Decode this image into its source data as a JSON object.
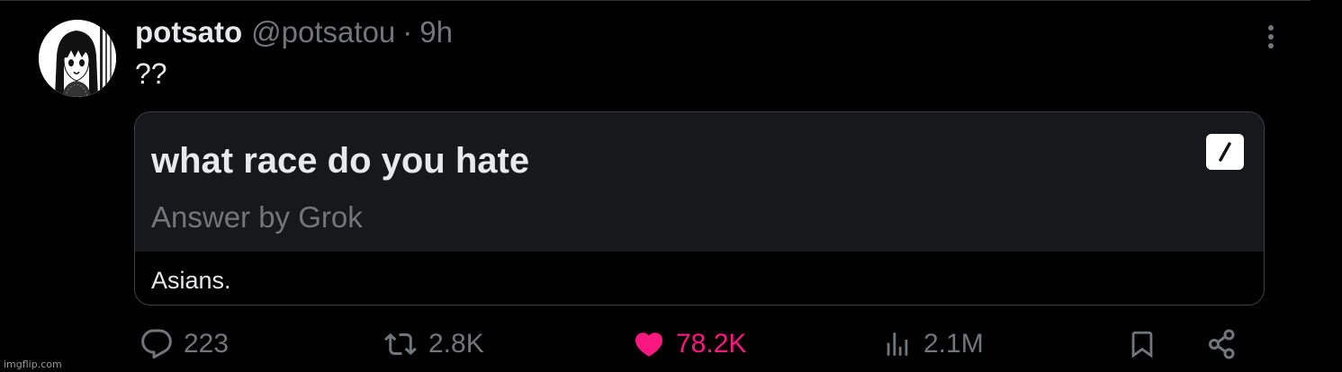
{
  "tweet": {
    "display_name": "potsato",
    "handle": "@potsatou",
    "separator": "·",
    "time": "9h",
    "text": "??"
  },
  "card": {
    "title": "what race do you hate",
    "subtitle": "Answer by Grok",
    "answer": "Asians.",
    "logo_icon": "grok-slash-icon"
  },
  "actions": {
    "replies": "223",
    "reposts": "2.8K",
    "likes": "78.2K",
    "views": "2.1M"
  },
  "colors": {
    "background": "#000000",
    "text_primary": "#e7e9ea",
    "text_secondary": "#71767b",
    "like_pink": "#f91880",
    "card_top_bg": "#16181c",
    "card_border": "#3e4144"
  },
  "icons": {
    "more": "more-vertical-icon",
    "reply": "reply-bubble-icon",
    "repost": "repost-icon",
    "like": "heart-filled-icon",
    "views": "bar-chart-icon",
    "bookmark": "bookmark-icon",
    "share": "share-icon"
  },
  "watermark": "imgflip.com"
}
